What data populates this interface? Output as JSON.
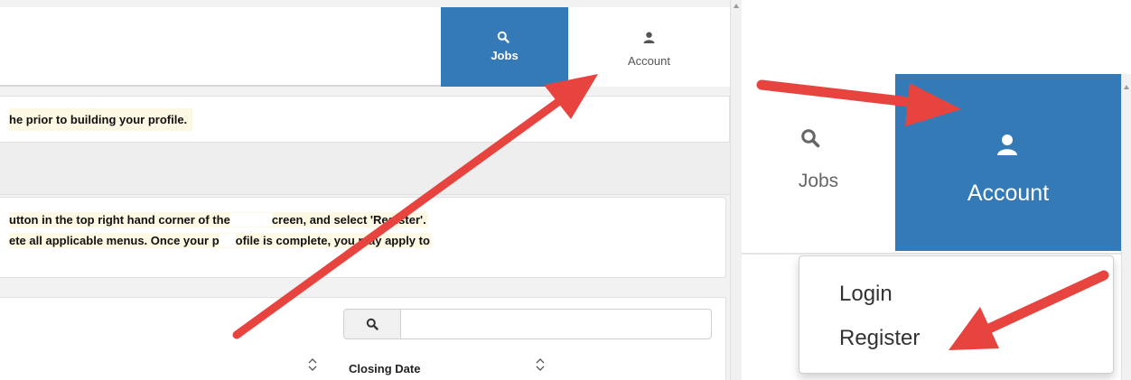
{
  "colors": {
    "primary_blue": "#337ab7",
    "highlight_yellow": "#fcf8e3",
    "arrow_red": "#e8443f"
  },
  "header": {
    "nav": [
      {
        "label": "Jobs",
        "icon": "search-icon",
        "active": true
      },
      {
        "label": "Account",
        "icon": "user-icon",
        "active": false
      }
    ]
  },
  "notice": {
    "text": "he prior to building your profile."
  },
  "instructions": {
    "line1_a": "utton in the top right hand corner of the",
    "line1_b": "creen, and select 'Register'.",
    "line2_a": "ete all applicable menus. Once your p",
    "line2_b": "ofile is complete, you may apply to"
  },
  "table": {
    "search": {
      "value": "",
      "placeholder": ""
    },
    "columns": [
      "Closing Date"
    ]
  },
  "zoom": {
    "nav": [
      {
        "label": "Jobs",
        "icon": "search-icon",
        "active": false
      },
      {
        "label": "Account",
        "icon": "user-icon",
        "active": true
      }
    ],
    "dropdown": {
      "items": [
        "Login",
        "Register"
      ]
    }
  }
}
